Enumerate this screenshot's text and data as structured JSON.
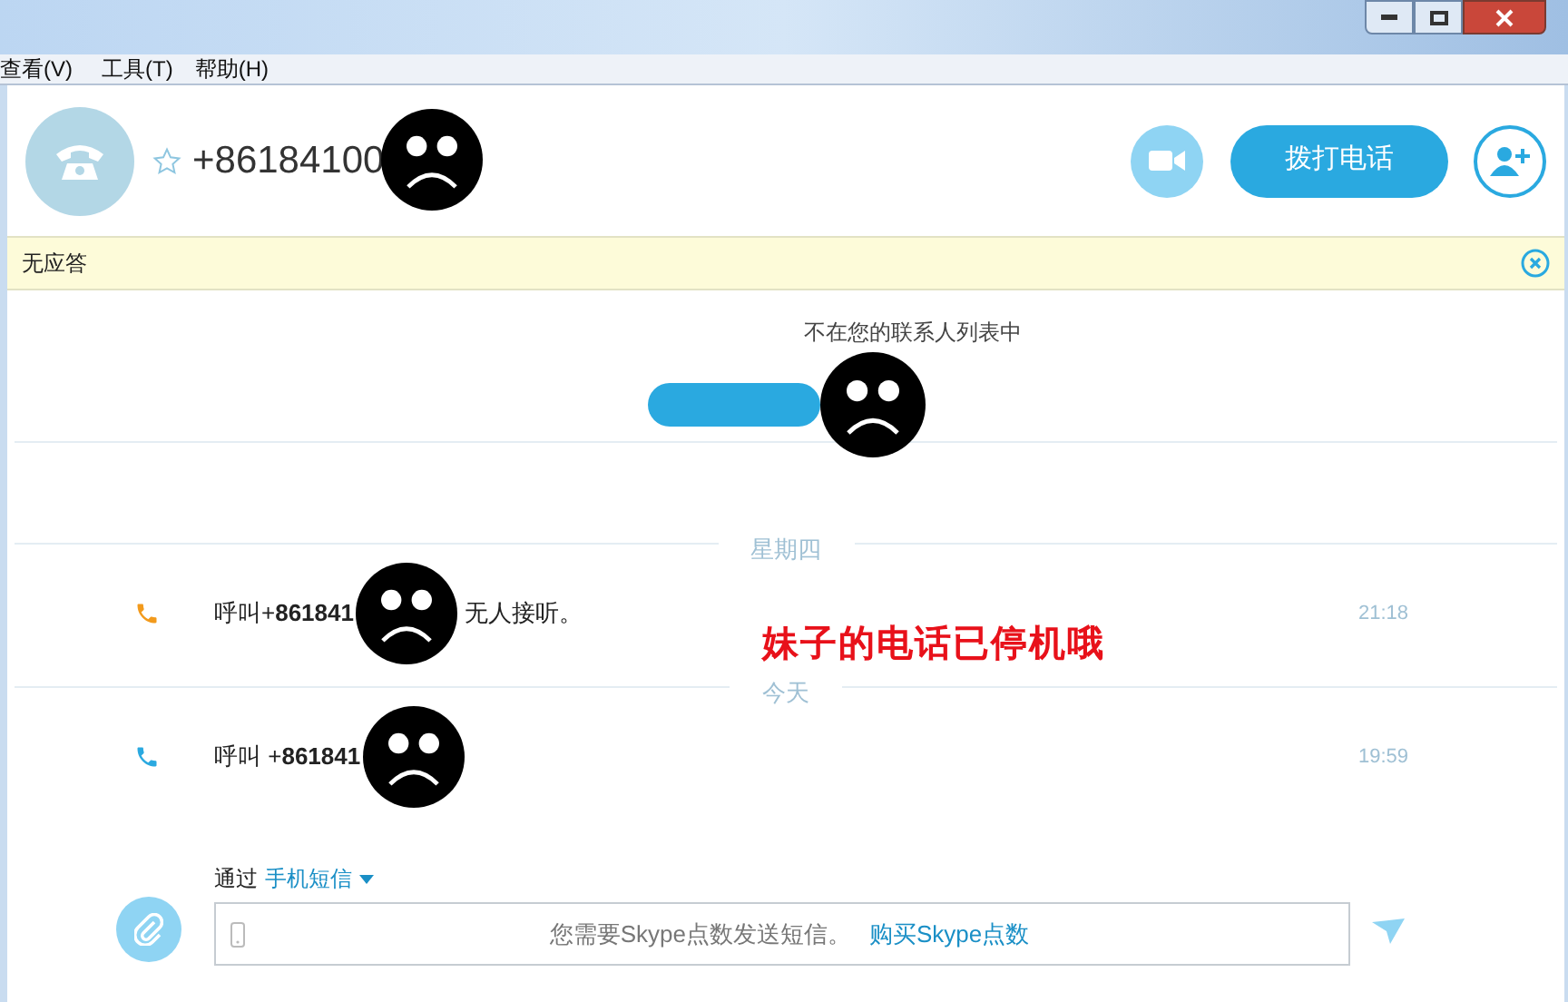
{
  "menu": [
    "查看(V)",
    "工具(T)",
    "帮助(H)"
  ],
  "contact": {
    "name": "+86184100",
    "favorite": false
  },
  "header_buttons": {
    "call": "拨打电话"
  },
  "notice_bar": {
    "text": "无应答"
  },
  "not_in_contacts": "不在您的联系人列表中",
  "history": [
    {
      "kind": "date",
      "text": "星期四"
    },
    {
      "kind": "call",
      "missed": true,
      "prefix": "呼叫+",
      "number": "861841",
      "suffix": "无人接听。",
      "time": "21:18"
    },
    {
      "kind": "date",
      "text": "今天"
    },
    {
      "kind": "call",
      "missed": false,
      "prefix": "呼叫 +",
      "number": "861841",
      "time": "19:59"
    }
  ],
  "annotation": "妹子的电话已停机哦",
  "composer": {
    "via_label": "通过",
    "via_option": "手机短信",
    "message": "您需要Skype点数发送短信。",
    "link": "购买Skype点数"
  }
}
